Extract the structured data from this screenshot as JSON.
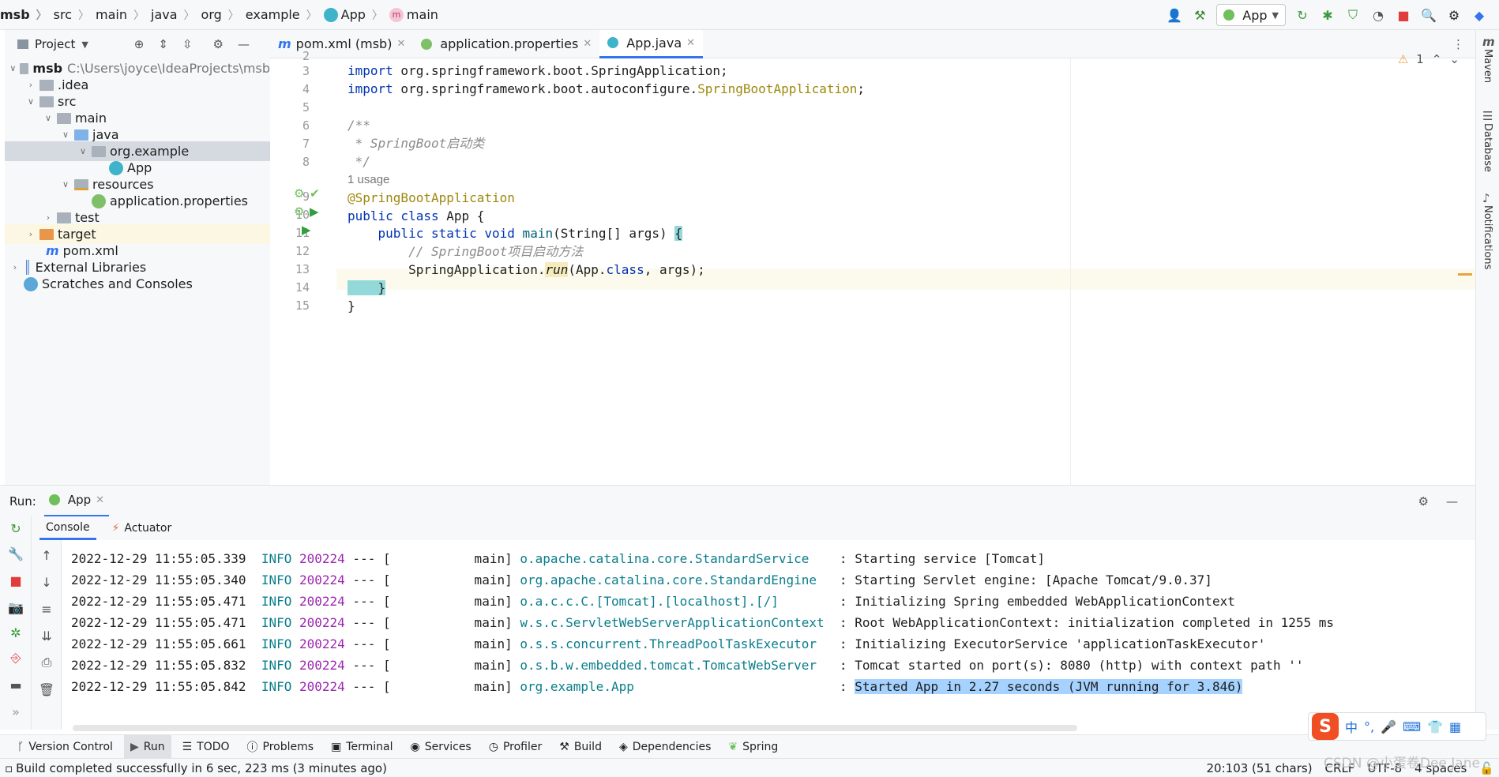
{
  "breadcrumb": [
    "msb",
    "src",
    "main",
    "java",
    "org",
    "example",
    "App",
    "main"
  ],
  "toolbar": {
    "run_config": "App"
  },
  "project_panel": {
    "title": "Project"
  },
  "tree": [
    {
      "label": "msb",
      "path": "C:\\Users\\joyce\\IdeaProjects\\msb"
    },
    {
      "label": ".idea"
    },
    {
      "label": "src"
    },
    {
      "label": "main"
    },
    {
      "label": "java"
    },
    {
      "label": "org.example"
    },
    {
      "label": "App"
    },
    {
      "label": "resources"
    },
    {
      "label": "application.properties"
    },
    {
      "label": "test"
    },
    {
      "label": "target"
    },
    {
      "label": "pom.xml"
    },
    {
      "label": "External Libraries"
    },
    {
      "label": "Scratches and Consoles"
    }
  ],
  "editor_tabs": [
    "pom.xml (msb)",
    "application.properties",
    "App.java"
  ],
  "editor": {
    "warning_count": "1",
    "line_numbers": [
      "2",
      "3",
      "4",
      "5",
      "6",
      "7",
      "8",
      "9",
      "10",
      "11",
      "12",
      "13",
      "14",
      "15"
    ],
    "usage_hint": "1 usage",
    "code": {
      "l3a": "import",
      "l3b": " org.springframework.boot.SpringApplication;",
      "l4a": "import",
      "l4b": " org.springframework.boot.autoconfigure.",
      "l4c": "SpringBootApplication",
      "l4d": ";",
      "l6": "/**",
      "l7": " * SpringBoot启动类",
      "l8": " */",
      "l9": "@SpringBootApplication",
      "l10a": "public class",
      "l10b": " App {",
      "l11a": "    public static void",
      "l11b": " main",
      "l11c": "(String[] args) ",
      "l11d": "{",
      "l12": "        // SpringBoot项目启动方法",
      "l13a": "        SpringApplication.",
      "l13b": "run",
      "l13c": "(App.",
      "l13d": "class",
      "l13e": ", args);",
      "l14": "    }",
      "l15": "}"
    }
  },
  "run_panel": {
    "label": "Run:",
    "tab": "App",
    "subtabs": [
      "Console",
      "Actuator"
    ]
  },
  "console_lines": [
    {
      "ts": "2022-12-29 11:55:05.339",
      "level": "INFO",
      "pid": "200224",
      "sep": " --- [",
      "thread": "           main]",
      "cls": " o.apache.catalina.core.StandardService   ",
      "msg": " : Starting service [Tomcat]"
    },
    {
      "ts": "2022-12-29 11:55:05.340",
      "level": "INFO",
      "pid": "200224",
      "sep": " --- [",
      "thread": "           main]",
      "cls": " org.apache.catalina.core.StandardEngine  ",
      "msg": " : Starting Servlet engine: [Apache Tomcat/9.0.37]"
    },
    {
      "ts": "2022-12-29 11:55:05.471",
      "level": "INFO",
      "pid": "200224",
      "sep": " --- [",
      "thread": "           main]",
      "cls": " o.a.c.c.C.[Tomcat].[localhost].[/]       ",
      "msg": " : Initializing Spring embedded WebApplicationContext"
    },
    {
      "ts": "2022-12-29 11:55:05.471",
      "level": "INFO",
      "pid": "200224",
      "sep": " --- [",
      "thread": "           main]",
      "cls": " w.s.c.ServletWebServerApplicationContext ",
      "msg": " : Root WebApplicationContext: initialization completed in 1255 ms"
    },
    {
      "ts": "2022-12-29 11:55:05.661",
      "level": "INFO",
      "pid": "200224",
      "sep": " --- [",
      "thread": "           main]",
      "cls": " o.s.s.concurrent.ThreadPoolTaskExecutor  ",
      "msg": " : Initializing ExecutorService 'applicationTaskExecutor'"
    },
    {
      "ts": "2022-12-29 11:55:05.832",
      "level": "INFO",
      "pid": "200224",
      "sep": " --- [",
      "thread": "           main]",
      "cls": " o.s.b.w.embedded.tomcat.TomcatWebServer  ",
      "msg": " : Tomcat started on port(s): 8080 (http) with context path ''"
    },
    {
      "ts": "2022-12-29 11:55:05.842",
      "level": "INFO",
      "pid": "200224",
      "sep": " --- [",
      "thread": "           main]",
      "cls": " org.example.App                          ",
      "msg_pre": " : ",
      "msg": "Started App in 2.27 seconds (JVM running for 3.846)"
    }
  ],
  "right_stripe": [
    "Maven",
    "Database",
    "Notifications"
  ],
  "bottom_tools": [
    "Version Control",
    "Run",
    "TODO",
    "Problems",
    "Terminal",
    "Services",
    "Profiler",
    "Build",
    "Dependencies",
    "Spring"
  ],
  "status": {
    "message": "Build completed successfully in 6 sec, 223 ms (3 minutes ago)",
    "position": "20:103 (51 chars)",
    "line_sep": "CRLF",
    "encoding": "UTF-8",
    "indent": "4 spaces"
  },
  "ime": {
    "lang": "中",
    "punct": "°,"
  },
  "watermark": "CSDN @小蛋卷Dee Jane",
  "colors": {
    "accent": "#3574f0",
    "keyword": "#0033b3",
    "annotation": "#9e880d",
    "log_class": "#0a7d8c",
    "pid": "#9c27b0",
    "highlight": "#a6d2ff"
  }
}
